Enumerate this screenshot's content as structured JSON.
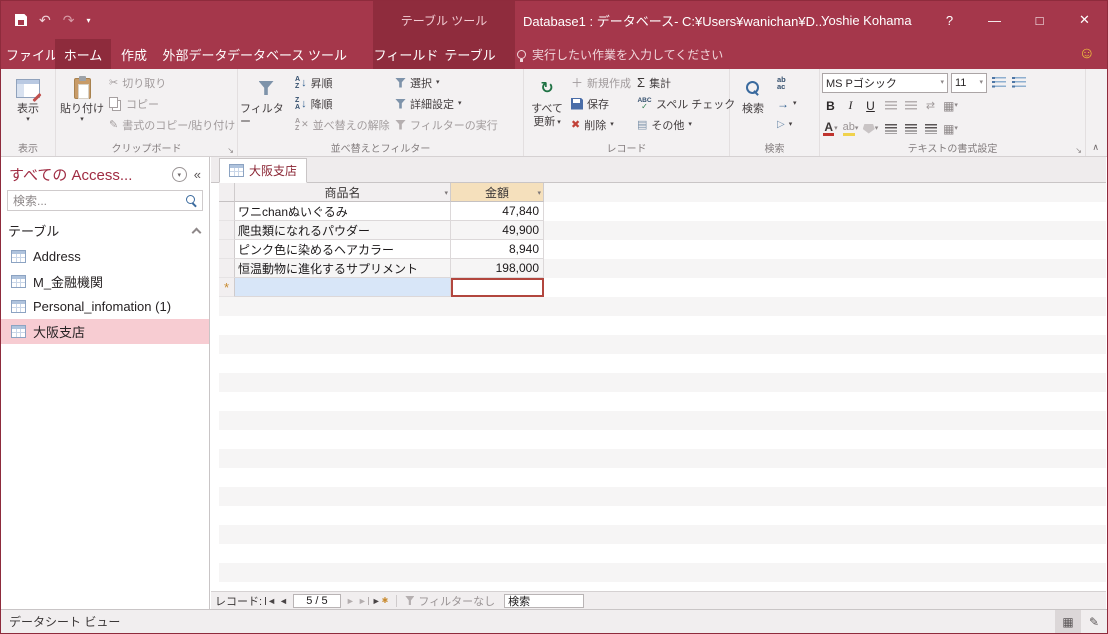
{
  "titlebar": {
    "contextual_label": "テーブル ツール",
    "title": "Database1 : データベース- C:¥Users¥wanichan¥D...",
    "user_name": "Yoshie Kohama",
    "help_label": "?",
    "minimize_label": "—",
    "maximize_label": "□",
    "close_label": "✕"
  },
  "ribbon_tabs": {
    "file": "ファイル",
    "home": "ホーム",
    "create": "作成",
    "external_data": "外部データ",
    "database_tools": "データベース ツール",
    "fields": "フィールド",
    "table": "テーブル",
    "tell_me": "実行したい作業を入力してください"
  },
  "ribbon": {
    "view": {
      "label": "表示",
      "group_label": "表示"
    },
    "clipboard": {
      "paste": "貼り付け",
      "cut": "切り取り",
      "copy": "コピー",
      "format_painter": "書式のコピー/貼り付け",
      "group_label": "クリップボード"
    },
    "sort_filter": {
      "filter": "フィルター",
      "ascending": "昇順",
      "descending": "降順",
      "clear_sort": "並べ替えの解除",
      "selection": "選択",
      "advanced": "詳細設定",
      "toggle_filter": "フィルターの実行",
      "group_label": "並べ替えとフィルター"
    },
    "records": {
      "refresh_all_1": "すべて",
      "refresh_all_2": "更新",
      "new": "新規作成",
      "save": "保存",
      "delete": "削除",
      "totals": "集計",
      "spelling": "スペル チェック",
      "more": "その他",
      "group_label": "レコード"
    },
    "find": {
      "find": "検索",
      "replace_top": "ab",
      "replace_bottom": "ac",
      "group_label": "検索"
    },
    "text_format": {
      "font_name": "MS Pゴシック",
      "font_size": "11",
      "bold": "B",
      "italic": "I",
      "underline": "U",
      "color_letter": "A",
      "highlight": "ab",
      "group_label": "テキストの書式設定"
    }
  },
  "nav_pane": {
    "title": "すべての Access...",
    "search_placeholder": "検索...",
    "group_label": "テーブル",
    "items": [
      {
        "label": "Address"
      },
      {
        "label": "M_金融機関"
      },
      {
        "label": "Personal_infomation (1)"
      },
      {
        "label": "大阪支店"
      }
    ]
  },
  "document": {
    "tab_label": "大阪支店",
    "columns": {
      "name": "商品名",
      "amount": "金額"
    },
    "rows": [
      {
        "name": "ワニchanぬいぐるみ",
        "amount": "47,840"
      },
      {
        "name": "爬虫類になれるパウダー",
        "amount": "49,900"
      },
      {
        "name": "ピンク色に染めるヘアカラー",
        "amount": "8,940"
      },
      {
        "name": "恒温動物に進化するサプリメント",
        "amount": "198,000"
      }
    ],
    "new_record_marker": "*",
    "record_nav": {
      "label": "レコード:",
      "position": "5 / 5",
      "filter_status": "フィルターなし",
      "search_text": "検索"
    }
  },
  "status_bar": {
    "view_label": "データシート ビュー"
  },
  "colors": {
    "accent": "#A5374B",
    "accent_dark": "#8E2B3C",
    "selection_pink": "#F7CCD2",
    "new_row_blue": "#D8E6F8",
    "active_column_tan": "#F5E0BC",
    "current_cell_border": "#B2463E"
  },
  "icons": {
    "undo": "↶",
    "redo": "↷",
    "caret": "▾",
    "smiley": "☺",
    "cut": "✂",
    "painter": "✎",
    "arrow_down": "↓",
    "x_small": "✕",
    "refresh": "↻",
    "plus": "＋",
    "delete_x": "✖",
    "sigma": "Σ",
    "abc": "ABC",
    "check": "✓",
    "more": "▤",
    "goto_arrow": "→",
    "select_arrow": "▷",
    "swap": "⇄",
    "grid": "▦",
    "pencil": "✎",
    "launcher": "↘",
    "collapse": "∧",
    "chevrons_collapse": "«",
    "nav_prev": "◄",
    "nav_next": "►",
    "star": "✱",
    "az_a": "A",
    "az_z": "Z"
  }
}
